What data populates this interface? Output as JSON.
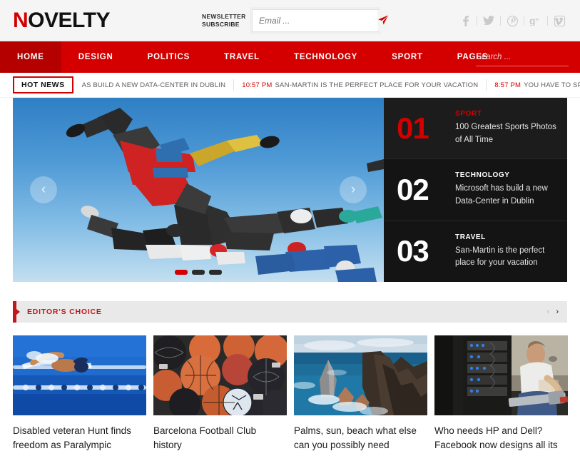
{
  "header": {
    "logo_first": "N",
    "logo_rest": "OVELTY",
    "newsletter_label": "NEWSLETTER SUBSCRIBE",
    "newsletter_line1": "NEWSLETTER",
    "newsletter_line2": "SUBSCRIBE",
    "email_placeholder": "Email ...",
    "email_value": "",
    "send_icon": "paper-plane-icon",
    "socials": [
      {
        "name": "facebook",
        "glyph": "f"
      },
      {
        "name": "twitter",
        "glyph": "t"
      },
      {
        "name": "pinterest",
        "glyph": "p"
      },
      {
        "name": "google-plus",
        "glyph": "g"
      },
      {
        "name": "vimeo",
        "glyph": "v"
      }
    ],
    "accent_color": "#d40000"
  },
  "nav": {
    "items": [
      {
        "label": "HOME",
        "active": true
      },
      {
        "label": "DESIGN",
        "active": false
      },
      {
        "label": "POLITICS",
        "active": false
      },
      {
        "label": "TRAVEL",
        "active": false
      },
      {
        "label": "TECHNOLOGY",
        "active": false
      },
      {
        "label": "SPORT",
        "active": false
      },
      {
        "label": "PAGES",
        "active": false
      }
    ],
    "search_placeholder": "Search ...",
    "search_value": "",
    "bg_color": "#d40000",
    "active_color": "#b50000"
  },
  "ticker": {
    "badge": "HOT NEWS",
    "items": [
      {
        "time": "",
        "text": "AS BUILD A NEW DATA-CENTER IN DUBLIN"
      },
      {
        "time": "10:57 PM",
        "text": "SAN-MARTIN IS THE PERFECT PLACE FOR YOUR VACATION"
      },
      {
        "time": "8:57 PM",
        "text": "YOU HAVE TO SPEND SOME TIME HERE TO UNDERSTAND \"WHAT GOOD LIF"
      }
    ]
  },
  "slider": {
    "prev_icon": "chevron-left-icon",
    "next_icon": "chevron-right-icon",
    "dots": [
      {
        "active": true
      },
      {
        "active": false
      },
      {
        "active": false
      }
    ],
    "items": [
      {
        "number": "01",
        "category": "SPORT",
        "title": "100 Greatest Sports Photos of All Time",
        "active": true
      },
      {
        "number": "02",
        "category": "TECHNOLOGY",
        "title": "Microsoft has build a new Data-Center in Dublin",
        "active": false
      },
      {
        "number": "03",
        "category": "TRAVEL",
        "title": "San-Martin is the perfect place for your vacation",
        "active": false
      }
    ]
  },
  "editors_choice": {
    "title": "EDITOR'S CHOICE",
    "prev_icon": "chevron-left-icon",
    "next_icon": "chevron-right-icon",
    "prev_glyph": "‹",
    "next_glyph": "›"
  },
  "cards": [
    {
      "title": "Disabled veteran Hunt finds freedom as Paralympic",
      "image_name": "swimmer-in-pool-photo"
    },
    {
      "title": "Barcelona Football Club history",
      "image_name": "pile-of-basketballs-photo"
    },
    {
      "title": "Palms, sun, beach what else can you possibly need",
      "image_name": "sea-cliffs-coastline-photo"
    },
    {
      "title": "Who needs HP and Dell? Facebook now designs all its",
      "image_name": "technician-at-server-rack-photo"
    }
  ]
}
